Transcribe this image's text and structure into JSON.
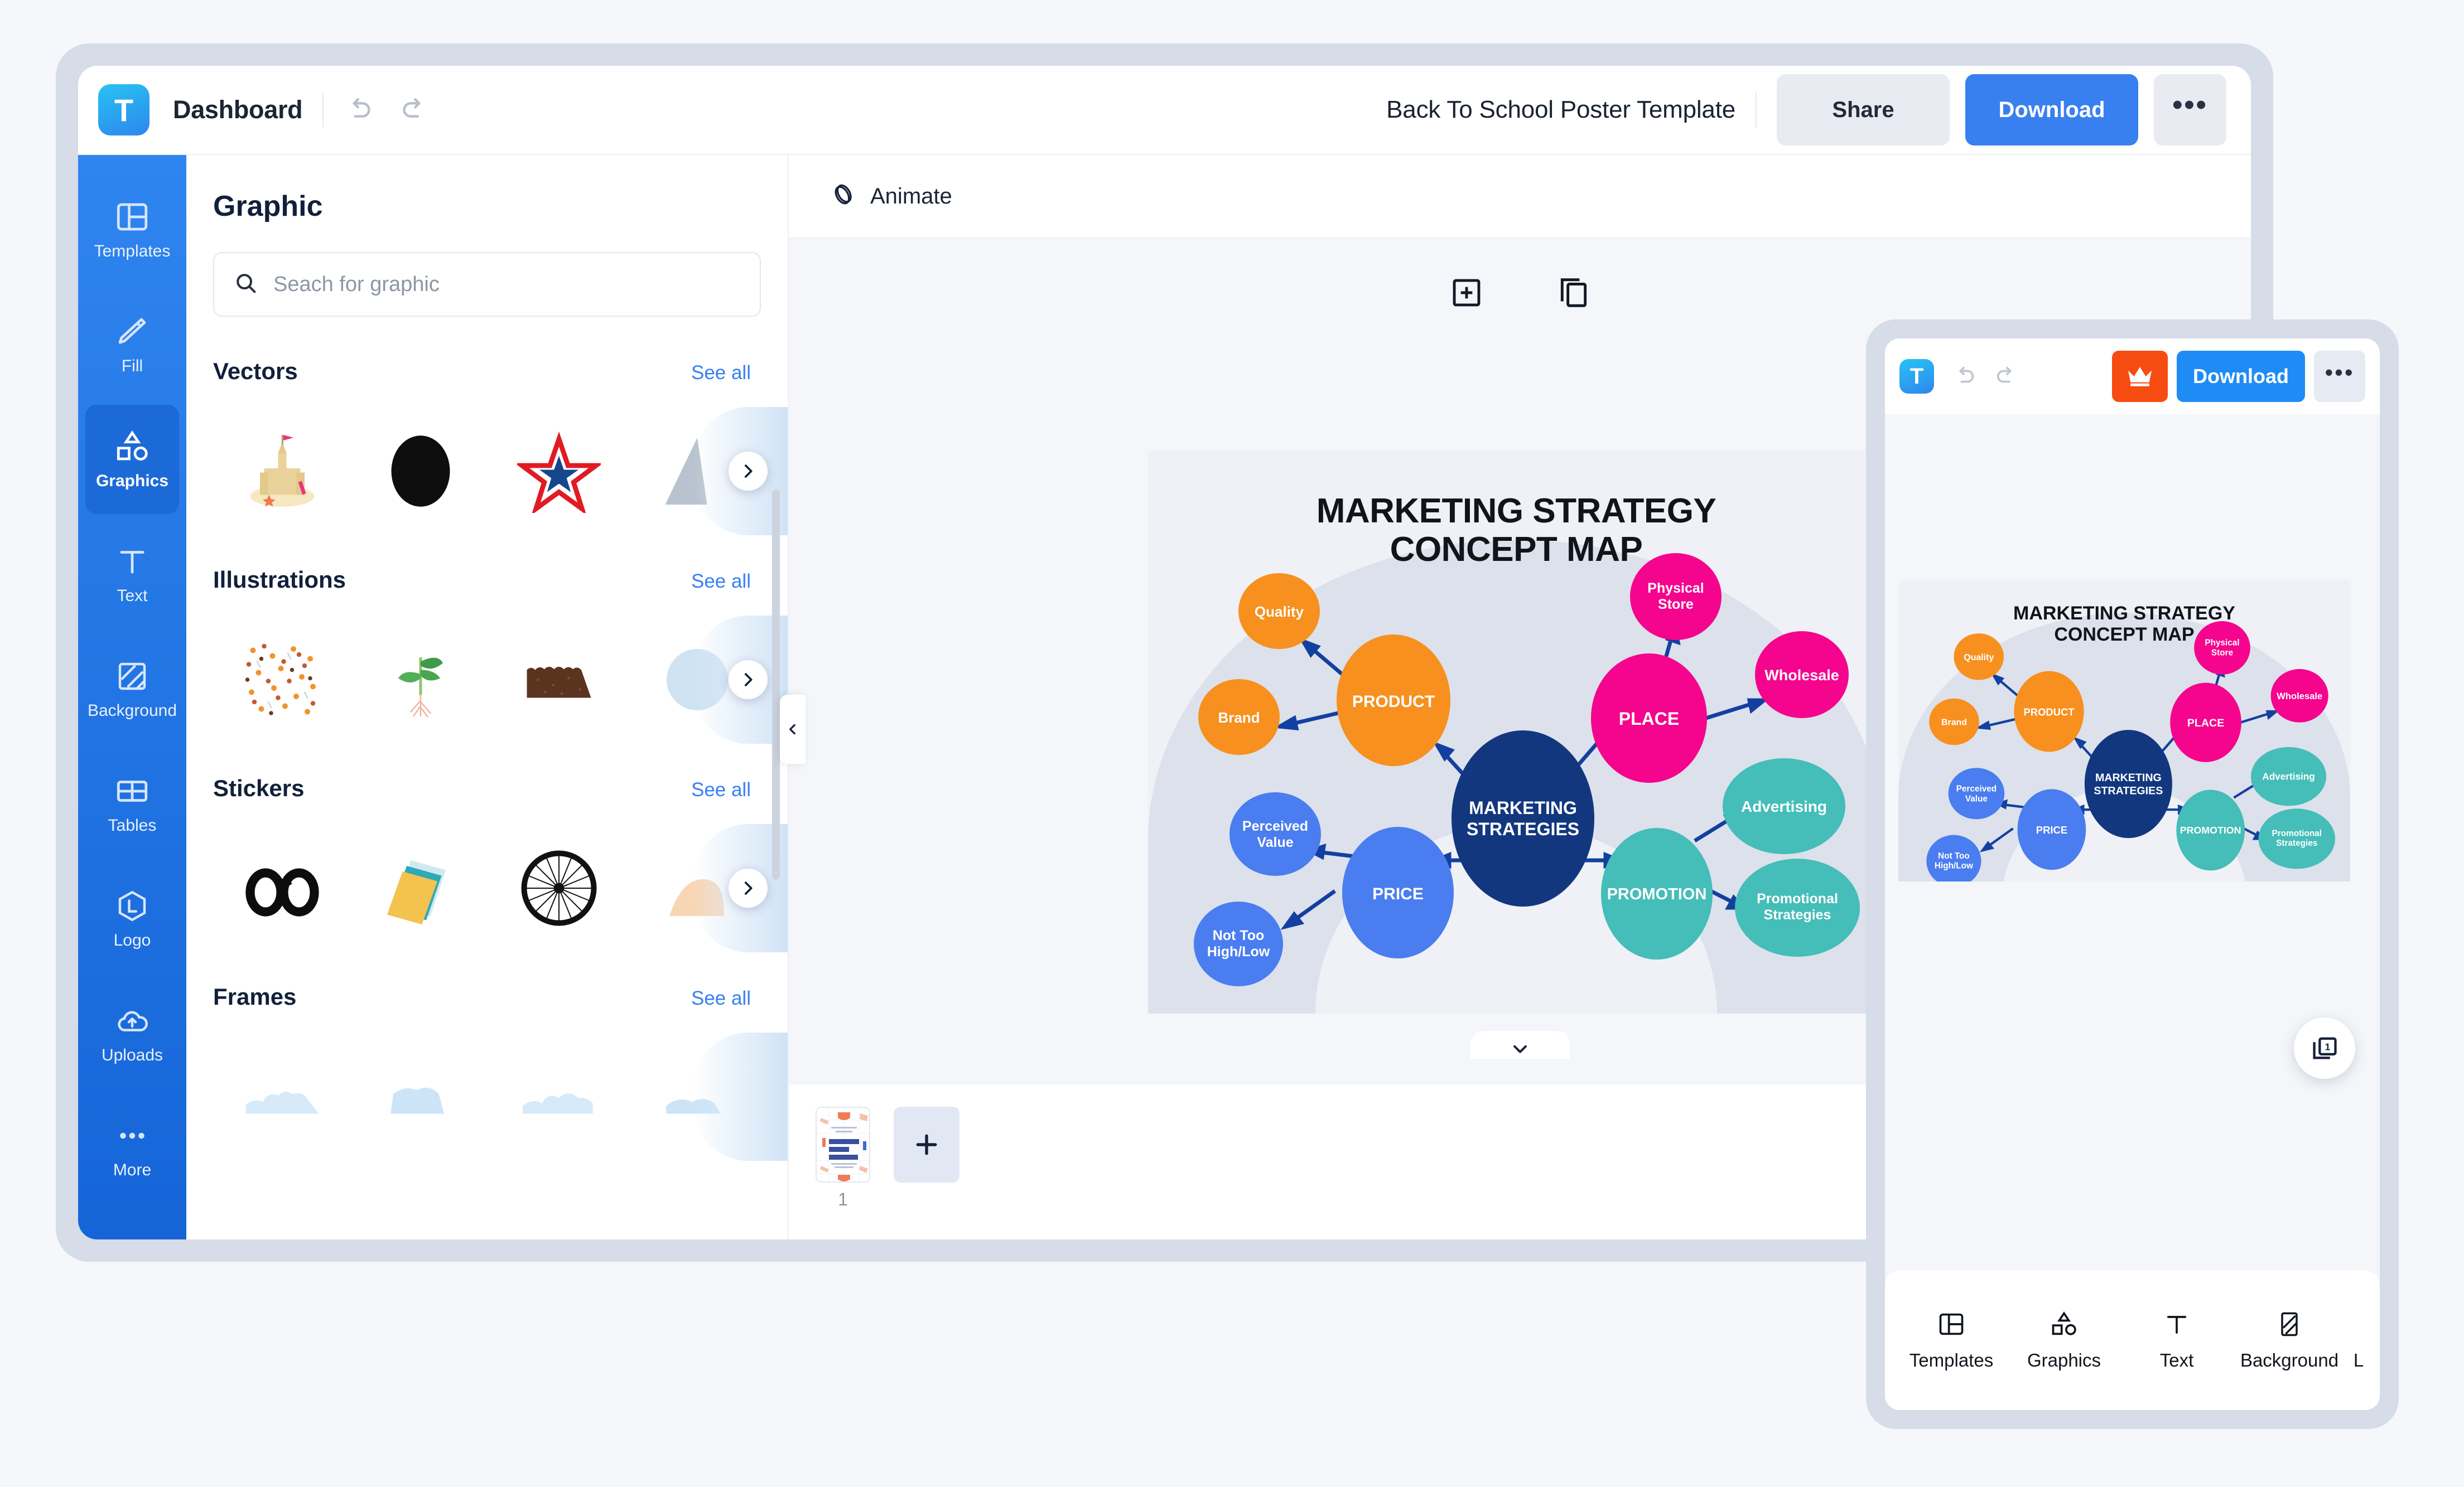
{
  "app": {
    "logo_letter": "T",
    "dashboard_label": "Dashboard",
    "doc_title": "Back To School Poster Template",
    "share_label": "Share",
    "download_label": "Download",
    "more_label": "•••"
  },
  "sidebar": {
    "items": [
      {
        "label": "Templates",
        "icon": "templates-icon",
        "active": false
      },
      {
        "label": "Fill",
        "icon": "pen-fill-icon",
        "active": false
      },
      {
        "label": "Graphics",
        "icon": "graphics-shapes-icon",
        "active": true
      },
      {
        "label": "Text",
        "icon": "text-t-icon",
        "active": false
      },
      {
        "label": "Background",
        "icon": "background-hatch-icon",
        "active": false
      },
      {
        "label": "Tables",
        "icon": "tables-grid-icon",
        "active": false
      },
      {
        "label": "Logo",
        "icon": "logo-hexagon-icon",
        "active": false
      },
      {
        "label": "Uploads",
        "icon": "cloud-upload-icon",
        "active": false
      },
      {
        "label": "More",
        "icon": "more-dots-icon",
        "active": false
      }
    ]
  },
  "panel": {
    "title": "Graphic",
    "search_placeholder": "Seach for graphic",
    "search_value": "",
    "search_icon": "search-icon",
    "sections": [
      {
        "title": "Vectors",
        "see_all": "See all"
      },
      {
        "title": "Illustrations",
        "see_all": "See all"
      },
      {
        "title": "Stickers",
        "see_all": "See all"
      },
      {
        "title": "Frames",
        "see_all": "See all"
      }
    ]
  },
  "toolbar": {
    "animate_label": "Animate",
    "animate_icon": "animate-layers-icon",
    "add_page_icon": "add-page-icon",
    "duplicate_page_icon": "duplicate-page-icon"
  },
  "pages": {
    "page_number": "1",
    "add_label": "+",
    "thumb_text_1": "WELCOME",
    "thumb_text_2": "BACK",
    "thumb_text_3": "STUDENTS"
  },
  "mobile": {
    "logo_letter": "T",
    "download_label": "Download",
    "more_label": "•••",
    "crown_icon": "crown-icon",
    "pages_badge": "1",
    "nav": [
      {
        "label": "Templates",
        "icon": "templates-icon"
      },
      {
        "label": "Graphics",
        "icon": "graphics-shapes-icon"
      },
      {
        "label": "Text",
        "icon": "text-t-icon"
      },
      {
        "label": "Background",
        "icon": "background-hatch-icon"
      },
      {
        "label": "L",
        "icon": "logo-hexagon-icon"
      }
    ]
  },
  "colors": {
    "brand_blue": "#3880f0",
    "rail_blue": "#1c6ad8",
    "orange": "#F7901E",
    "pink": "#F5048D",
    "teal": "#45BDB8",
    "blue_node": "#4A7DEF",
    "navy": "#12377F",
    "arrow": "#1340A0",
    "canvas_bg": "#EFF1F6",
    "arc_bg": "#DCE1EC",
    "crown_orange": "#f64c12"
  },
  "chart_data": {
    "type": "diagram",
    "title": "MARKETING STRATEGY CONCEPT MAP",
    "center": {
      "label": "MARKETING STRATEGIES",
      "color": "#12377F"
    },
    "branches": [
      {
        "label": "PRODUCT",
        "color": "#F7901E",
        "children": [
          {
            "label": "Quality",
            "color": "#F7901E"
          },
          {
            "label": "Brand",
            "color": "#F7901E"
          }
        ]
      },
      {
        "label": "PLACE",
        "color": "#F5048D",
        "children": [
          {
            "label": "Physical Store",
            "color": "#F5048D"
          },
          {
            "label": "Wholesale",
            "color": "#F5048D"
          }
        ]
      },
      {
        "label": "PRICE",
        "color": "#4A7DEF",
        "children": [
          {
            "label": "Perceived Value",
            "color": "#4A7DEF"
          },
          {
            "label": "Not Too High/Low",
            "color": "#4A7DEF"
          }
        ]
      },
      {
        "label": "PROMOTION",
        "color": "#45BDB8",
        "children": [
          {
            "label": "Advertising",
            "color": "#45BDB8"
          },
          {
            "label": "Promotional Strategies",
            "color": "#45BDB8"
          }
        ]
      }
    ]
  }
}
